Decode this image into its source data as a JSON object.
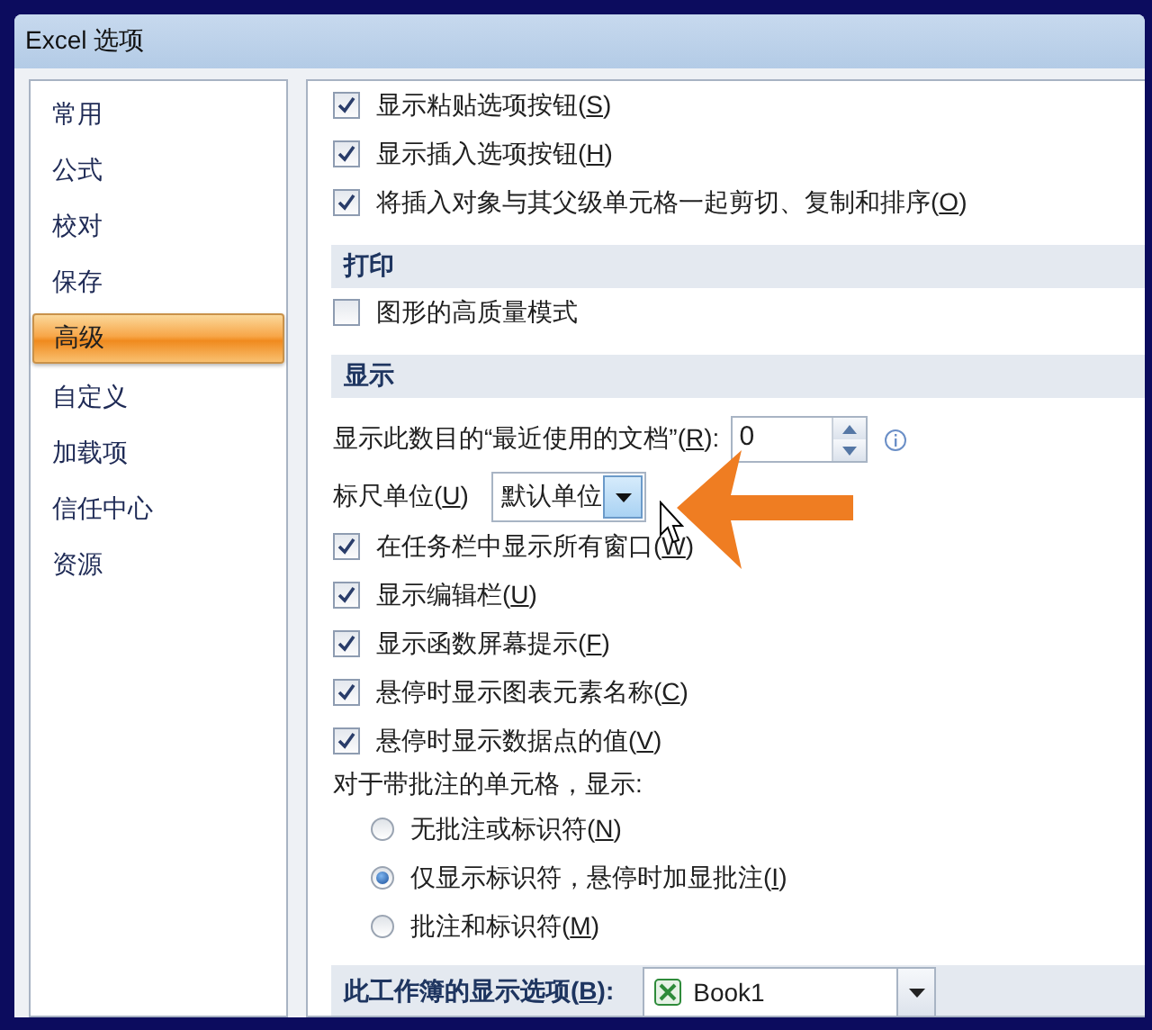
{
  "window": {
    "title": "Excel 选项"
  },
  "sidebar": {
    "items": [
      {
        "label": "常用",
        "selected": false
      },
      {
        "label": "公式",
        "selected": false
      },
      {
        "label": "校对",
        "selected": false
      },
      {
        "label": "保存",
        "selected": false
      },
      {
        "label": "高级",
        "selected": true
      },
      {
        "label": "自定义",
        "selected": false
      },
      {
        "label": "加载项",
        "selected": false
      },
      {
        "label": "信任中心",
        "selected": false
      },
      {
        "label": "资源",
        "selected": false
      }
    ]
  },
  "content": [
    {
      "kind": "checkbox",
      "label": "显示粘贴选项按钮(S)",
      "checked": true
    },
    {
      "kind": "checkbox",
      "label": "显示插入选项按钮(H)",
      "checked": true
    },
    {
      "kind": "checkbox",
      "label": "将插入对象与其父级单元格一起剪切、复制和排序(O)",
      "checked": true
    },
    {
      "kind": "header",
      "label": "打印"
    },
    {
      "kind": "checkbox",
      "label": "图形的高质量模式",
      "checked": false
    },
    {
      "kind": "header",
      "label": "显示"
    },
    {
      "kind": "spinner",
      "label": "显示此数目的“最近使用的文档”(R):",
      "value": "0"
    },
    {
      "kind": "dropdown",
      "label": "标尺单位(U)",
      "value": "默认单位"
    },
    {
      "kind": "checkbox",
      "label": "在任务栏中显示所有窗口(W)",
      "checked": true
    },
    {
      "kind": "checkbox",
      "label": "显示编辑栏(U)",
      "checked": true
    },
    {
      "kind": "checkbox",
      "label": "显示函数屏幕提示(F)",
      "checked": true
    },
    {
      "kind": "checkbox",
      "label": "悬停时显示图表元素名称(C)",
      "checked": true
    },
    {
      "kind": "checkbox",
      "label": "悬停时显示数据点的值(V)",
      "checked": true
    },
    {
      "kind": "text",
      "label": "对于带批注的单元格，显示:"
    },
    {
      "kind": "radio",
      "label": "无批注或标识符(N)",
      "selected": false
    },
    {
      "kind": "radio",
      "label": "仅显示标识符，悬停时加显批注(I)",
      "selected": true
    },
    {
      "kind": "radio",
      "label": "批注和标识符(M)",
      "selected": false
    },
    {
      "kind": "header-combo",
      "label": "此工作簿的显示选项(B):",
      "value": "Book1"
    }
  ]
}
